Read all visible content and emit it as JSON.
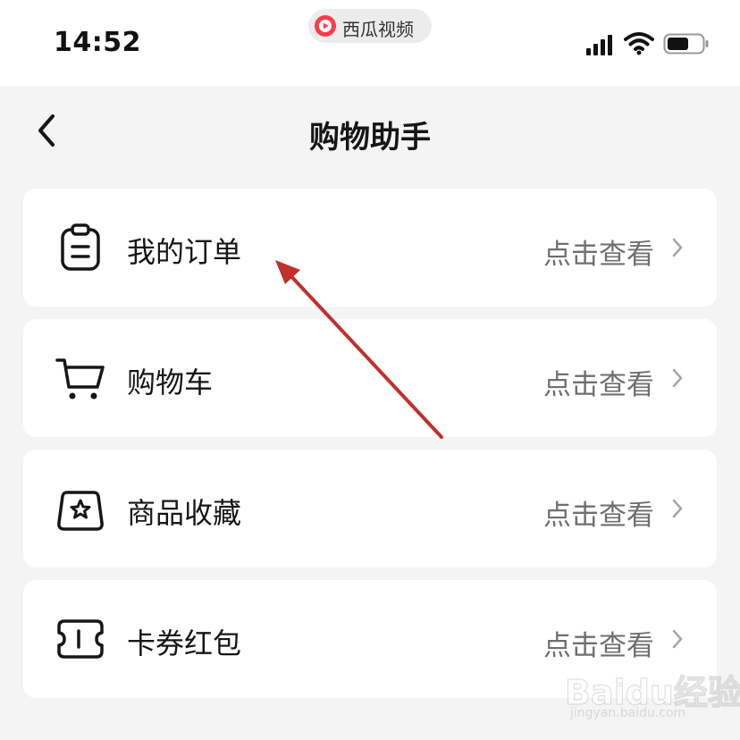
{
  "status_bar": {
    "time": "14:52",
    "app_name": "西瓜视频",
    "app_logo_color": "#fe3b4b",
    "icons": [
      "signal-icon",
      "wifi-icon",
      "battery-icon"
    ]
  },
  "nav": {
    "back_icon": "chevron-left-icon",
    "title": "购物助手"
  },
  "menu": {
    "items": [
      {
        "label": "我的订单",
        "action": "点击查看",
        "icon": "order-clipboard-icon"
      },
      {
        "label": "购物车",
        "action": "点击查看",
        "icon": "shopping-cart-icon"
      },
      {
        "label": "商品收藏",
        "action": "点击查看",
        "icon": "favorite-bag-star-icon"
      },
      {
        "label": "卡券红包",
        "action": "点击查看",
        "icon": "coupon-ticket-icon"
      }
    ]
  },
  "annotation": {
    "color": "#c0302c"
  },
  "watermark": {
    "brand": "Baidu经验",
    "url": "jingyan.baidu.com"
  }
}
